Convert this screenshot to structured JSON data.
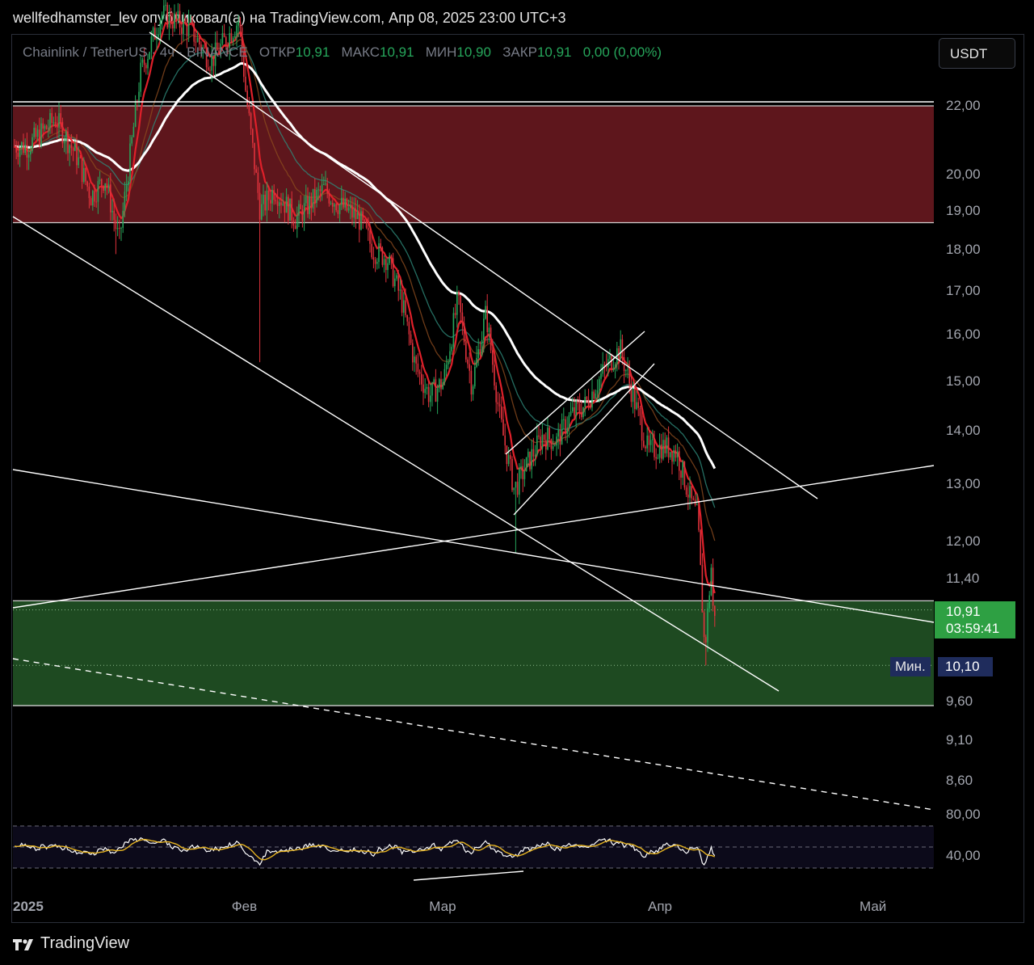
{
  "header": {
    "text": "wellfedhamster_lev опубликовал(а) на TradingView.com, Апр 08, 2025 23:00 UTC+3"
  },
  "legend": {
    "symbol": "Chainlink / TetherUS · 4ч · BINANCE",
    "open_label": "ОТКР",
    "open": "10,91",
    "high_label": "МАКС",
    "high": "10,91",
    "low_label": "МИН",
    "low": "10,90",
    "close_label": "ЗАКР",
    "close": "10,91",
    "change": "0,00 (0,00%)"
  },
  "currency_button": "USDT",
  "price_badge": {
    "price": "10,91",
    "countdown": "03:59:41"
  },
  "min_marker": {
    "label": "Мин.",
    "value": "10,10"
  },
  "footer": {
    "brand": "TradingView"
  },
  "colors": {
    "background": "#000000",
    "up": "#26a65b",
    "down": "#e0323c",
    "resistance_zone": "#5e161c",
    "support_zone": "#1e4a21",
    "ema_fast": "#e0202a",
    "ema_slow": "#ffffff",
    "rsi": "#ffffff",
    "rsi_ma": "#e6b422"
  },
  "chart_data": {
    "type": "candlestick",
    "title": "Chainlink / TetherUS · 4ч · BINANCE",
    "y_scale": "log",
    "price_ticks": [
      "22,00",
      "20,00",
      "19,00",
      "18,00",
      "17,00",
      "16,00",
      "15,00",
      "14,00",
      "13,00",
      "12,00",
      "11,40",
      "9,60",
      "9,10",
      "8,60"
    ],
    "x_ticks": [
      "2025",
      "Фев",
      "Мар",
      "Апр",
      "Май"
    ],
    "last_price": 10.91,
    "period_low": 10.1,
    "zones": [
      {
        "name": "resistance",
        "from": 18.7,
        "to": 22.0,
        "color": "#5e161c"
      },
      {
        "name": "support",
        "from": 9.55,
        "to": 11.05,
        "color": "#1e4a21"
      }
    ],
    "price_path": [
      {
        "date": "2025-01-01",
        "close": 20.8
      },
      {
        "date": "2025-01-05",
        "close": 21.6
      },
      {
        "date": "2025-01-08",
        "close": 20.5
      },
      {
        "date": "2025-01-10",
        "close": 19.4
      },
      {
        "date": "2025-01-12",
        "close": 19.9
      },
      {
        "date": "2025-01-14",
        "close": 18.2
      },
      {
        "date": "2025-01-17",
        "close": 23.0
      },
      {
        "date": "2025-01-20",
        "close": 25.0
      },
      {
        "date": "2025-01-24",
        "close": 24.5
      },
      {
        "date": "2025-01-27",
        "close": 23.4
      },
      {
        "date": "2025-01-31",
        "close": 24.8
      },
      {
        "date": "2025-02-01",
        "close": 22.3
      },
      {
        "date": "2025-02-03",
        "close": 19.0
      },
      {
        "date": "2025-02-05",
        "close": 19.6
      },
      {
        "date": "2025-02-08",
        "close": 18.8
      },
      {
        "date": "2025-02-12",
        "close": 19.6
      },
      {
        "date": "2025-02-14",
        "close": 19.2
      },
      {
        "date": "2025-02-17",
        "close": 18.8
      },
      {
        "date": "2025-02-19",
        "close": 18.0
      },
      {
        "date": "2025-02-21",
        "close": 17.8
      },
      {
        "date": "2025-02-23",
        "close": 16.8
      },
      {
        "date": "2025-02-25",
        "close": 15.3
      },
      {
        "date": "2025-02-27",
        "close": 14.7
      },
      {
        "date": "2025-03-01",
        "close": 15.0
      },
      {
        "date": "2025-03-03",
        "close": 16.8
      },
      {
        "date": "2025-03-05",
        "close": 14.9
      },
      {
        "date": "2025-03-07",
        "close": 16.5
      },
      {
        "date": "2025-03-09",
        "close": 14.2
      },
      {
        "date": "2025-03-11",
        "close": 12.9
      },
      {
        "date": "2025-03-13",
        "close": 13.4
      },
      {
        "date": "2025-03-15",
        "close": 13.9
      },
      {
        "date": "2025-03-17",
        "close": 13.8
      },
      {
        "date": "2025-03-19",
        "close": 14.3
      },
      {
        "date": "2025-03-21",
        "close": 14.5
      },
      {
        "date": "2025-03-24",
        "close": 15.3
      },
      {
        "date": "2025-03-26",
        "close": 15.7
      },
      {
        "date": "2025-03-28",
        "close": 14.6
      },
      {
        "date": "2025-03-30",
        "close": 13.6
      },
      {
        "date": "2025-04-01",
        "close": 13.7
      },
      {
        "date": "2025-04-03",
        "close": 13.6
      },
      {
        "date": "2025-04-05",
        "close": 12.7
      },
      {
        "date": "2025-04-06",
        "close": 12.4
      },
      {
        "date": "2025-04-07",
        "close": 10.3
      },
      {
        "date": "2025-04-08",
        "close": 11.7
      },
      {
        "date": "2025-04-08",
        "close": 10.91
      }
    ],
    "rsi": {
      "levels": [
        "80,00",
        "40,00"
      ],
      "last": 40
    }
  }
}
